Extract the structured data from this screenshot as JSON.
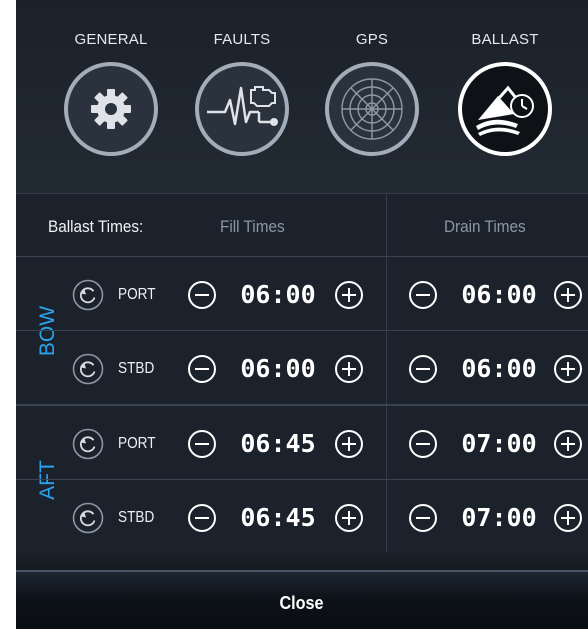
{
  "nav": {
    "items": [
      {
        "label": "GENERAL",
        "icon": "gear-icon"
      },
      {
        "label": "FAULTS",
        "icon": "engine-fault-icon"
      },
      {
        "label": "GPS",
        "icon": "radar-icon"
      },
      {
        "label": "BALLAST",
        "icon": "ballast-wave-clock-icon"
      }
    ],
    "active": "BALLAST"
  },
  "table": {
    "header": {
      "label": "Ballast Times:",
      "fill": "Fill Times",
      "drain": "Drain Times"
    },
    "groups": [
      {
        "label": "BOW",
        "rows": [
          {
            "side": "PORT",
            "fill": "06:00",
            "drain": "06:00"
          },
          {
            "side": "STBD",
            "fill": "06:00",
            "drain": "06:00"
          }
        ]
      },
      {
        "label": "AFT",
        "rows": [
          {
            "side": "PORT",
            "fill": "06:45",
            "drain": "07:00"
          },
          {
            "side": "STBD",
            "fill": "06:45",
            "drain": "07:00"
          }
        ]
      }
    ]
  },
  "footer": {
    "close_label": "Close"
  },
  "colors": {
    "accent": "#2aa3ee",
    "background": "#1c222b",
    "muted_text": "#8b97a5"
  }
}
